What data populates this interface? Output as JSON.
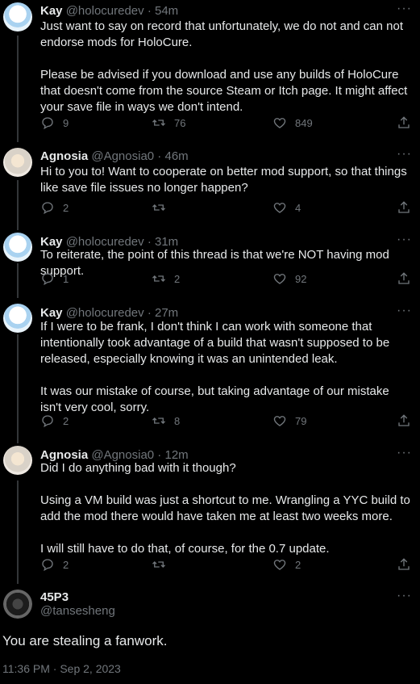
{
  "tweets": [
    {
      "name": "Kay",
      "handle": "@holocuredev",
      "time": "54m",
      "text": "Just want to say on record that unfortunately, we do not and can not endorse mods for HoloCure.\n\nPlease be advised if you download and use any builds of HoloCure that doesn't come from the source Steam or Itch page. It might affect your save file in ways we don't intend.",
      "replies": "9",
      "retweets": "76",
      "likes": "849"
    },
    {
      "name": "Agnosia",
      "handle": "@Agnosia0",
      "time": "46m",
      "text": "Hi to you to! Want to cooperate on better mod support, so that things like save file issues no longer happen?",
      "replies": "2",
      "retweets": "",
      "likes": "4"
    },
    {
      "name": "Kay",
      "handle": "@holocuredev",
      "time": "31m",
      "text": "To reiterate, the point of this thread is that we're NOT having mod support.",
      "replies": "1",
      "retweets": "2",
      "likes": "92"
    },
    {
      "name": "Kay",
      "handle": "@holocuredev",
      "time": "27m",
      "text": "If I were to be frank, I don't think I can work with someone that intentionally took advantage of a build that wasn't supposed to be released, especially knowing it was an unintended leak.\n\nIt was our mistake of course, but taking advantage of our mistake isn't very cool, sorry.",
      "replies": "2",
      "retweets": "8",
      "likes": "79"
    },
    {
      "name": "Agnosia",
      "handle": "@Agnosia0",
      "time": "12m",
      "text": "Did I do anything bad with it though?\n\nUsing a VM build was just a shortcut to me. Wrangling a YYC build to add the mod there would have taken me at least two weeks more.\n\nI will still have to do that, of course, for the 0.7 update.",
      "replies": "2",
      "retweets": "",
      "likes": "2"
    }
  ],
  "main": {
    "name": "45P3",
    "handle": "@tansesheng",
    "text": "You are stealing a fanwork.",
    "timestamp": "11:36 PM · Sep 2, 2023"
  },
  "more_glyph": "···",
  "sep": " · "
}
